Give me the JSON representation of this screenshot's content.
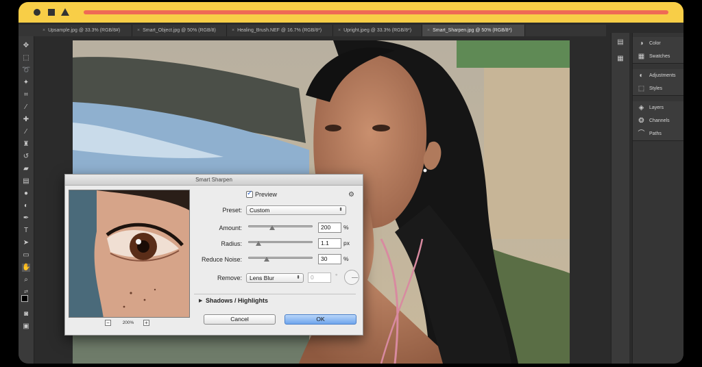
{
  "tabs": [
    {
      "label": "Upsample.jpg @ 33.3% (RGB/8#)",
      "close": "×"
    },
    {
      "label": "Smart_Object.jpg @ 50% (RGB/8)",
      "close": "×"
    },
    {
      "label": "Healing_Brush.NEF @ 16.7% (RGB/8*)",
      "close": "×"
    },
    {
      "label": "Upright.jpeg @ 33.3% (RGB/8*)",
      "close": "×"
    },
    {
      "label": "Smart_Sharpen.jpg @ 50% (RGB/8*)",
      "close": "×"
    }
  ],
  "panels": {
    "group1": [
      {
        "label": "Color",
        "icon": "color-wheel-icon"
      },
      {
        "label": "Swatches",
        "icon": "grid-icon"
      }
    ],
    "group2": [
      {
        "label": "Adjustments",
        "icon": "adjustment-icon"
      },
      {
        "label": "Styles",
        "icon": "styles-icon"
      }
    ],
    "group3": [
      {
        "label": "Layers",
        "icon": "layers-icon"
      },
      {
        "label": "Channels",
        "icon": "channels-icon"
      },
      {
        "label": "Paths",
        "icon": "pen-path-icon"
      }
    ]
  },
  "dialog": {
    "title": "Smart Sharpen",
    "preview_label": "Preview",
    "preview_checked": true,
    "preset_label": "Preset:",
    "preset_value": "Custom",
    "amount_label": "Amount:",
    "amount_value": "200",
    "amount_unit": "%",
    "radius_label": "Radius:",
    "radius_value": "1.1",
    "radius_unit": "px",
    "noise_label": "Reduce Noise:",
    "noise_value": "30",
    "noise_unit": "%",
    "remove_label": "Remove:",
    "remove_value": "Lens Blur",
    "angle_value": "0",
    "angle_unit": "°",
    "shadows_label": "Shadows / Highlights",
    "zoom_value": "200%",
    "zoom_minus": "−",
    "zoom_plus": "+",
    "cancel_label": "Cancel",
    "ok_label": "OK"
  },
  "colors": {
    "titlebar": "#f8ce47",
    "titlebar_accent": "#ef6a55",
    "app_background": "#2b2b2b",
    "ok_button": "#6fa5ec"
  }
}
